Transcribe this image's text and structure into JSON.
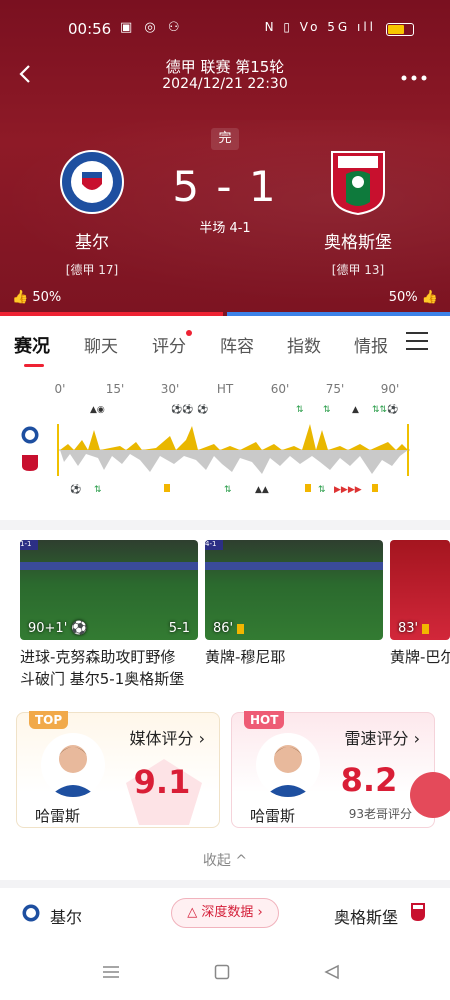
{
  "status_bar": {
    "time": "00:56",
    "left_icons": "▣ ◎ ⚇",
    "right_icons": "N ▯ Vo 5G ıll"
  },
  "header": {
    "league_round": "德甲 联赛 第15轮",
    "datetime": "2024/12/21 22:30",
    "match_status": "完",
    "score": "5 - 1",
    "halftime": "半场 4-1"
  },
  "home_team": {
    "name": "基尔",
    "rank": "[德甲 17]",
    "vote": "50%",
    "primary_color": "#1e4fa0"
  },
  "away_team": {
    "name": "奥格斯堡",
    "rank": "[德甲 13]",
    "vote": "50%",
    "primary_color": "#c8102e"
  },
  "tabs": [
    "赛况",
    "聊天",
    "评分",
    "阵容",
    "指数",
    "情报"
  ],
  "timeline": {
    "ticks": [
      "0'",
      "15'",
      "30'",
      "HT",
      "60'",
      "75'",
      "90'"
    ]
  },
  "videos": [
    {
      "time": "90+1'",
      "score": "5-1",
      "caption_line1": "进球-克努森助攻盯野修",
      "caption_line2": "斗破门 基尔5-1奥格斯堡"
    },
    {
      "time": "86'",
      "score": "",
      "caption_line1": "黄牌-穆尼耶",
      "caption_line2": ""
    },
    {
      "time": "83'",
      "score": "",
      "caption_line1": "黄牌-巴尔",
      "caption_line2": ""
    }
  ],
  "rating_cards": {
    "media": {
      "tag": "TOP",
      "title": "媒体评分 ›",
      "player": "哈雷斯",
      "score": "9.1"
    },
    "hot": {
      "tag": "HOT",
      "title": "雷速评分 ›",
      "player": "哈雷斯",
      "score": "8.2",
      "sub": "93老哥评分"
    }
  },
  "collapse_label": "收起 ^",
  "footer": {
    "home": "基尔",
    "deep_data": "深度数据 ›",
    "away": "奥格斯堡"
  },
  "colors": {
    "accent": "#e2233a",
    "hero_bg": "#8e1a27",
    "home_blue": "#1e4fa0",
    "away_red": "#c8102e",
    "bar_yellow": "#e9b700"
  }
}
